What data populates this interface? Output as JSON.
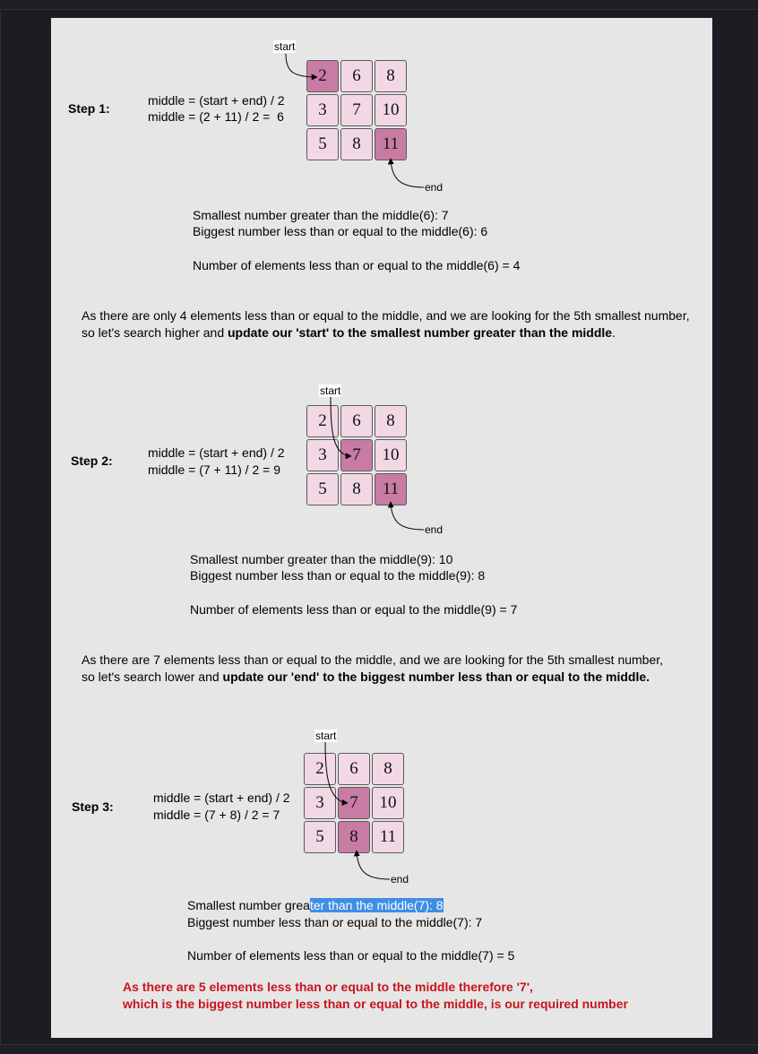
{
  "step1": {
    "label": "Step 1:",
    "formula1": "middle = (start + end) / 2",
    "formula2": "middle = (2 + 11) / 2 =  6",
    "start_tag": "start",
    "end_tag": "end",
    "matrix": [
      [
        "2",
        "6",
        "8"
      ],
      [
        "3",
        "7",
        "10"
      ],
      [
        "5",
        "8",
        "11"
      ]
    ],
    "info1": "Smallest number greater than the middle(6): 7",
    "info2": "Biggest number less than or equal to the middle(6): 6",
    "info3": "Number of elements less than or equal to the middle(6) = 4",
    "para_line1": "As there are only 4 elements less than or equal to the middle, and we are looking for the 5th smallest number,",
    "para_line2_prefix": "so let's search higher and ",
    "para_line2_bold": "update our 'start' to the smallest number greater than the middle",
    "para_line2_suffix": "."
  },
  "step2": {
    "label": "Step 2:",
    "formula1": "middle = (start + end) / 2",
    "formula2": "middle = (7 + 11) / 2 = 9",
    "start_tag": "start",
    "end_tag": "end",
    "matrix": [
      [
        "2",
        "6",
        "8"
      ],
      [
        "3",
        "7",
        "10"
      ],
      [
        "5",
        "8",
        "11"
      ]
    ],
    "info1": "Smallest number greater than the middle(9): 10",
    "info2": "Biggest number less than or equal to the middle(9): 8",
    "info3": "Number of elements less than or equal to the middle(9) = 7",
    "para_line1": "As there are 7 elements less than or equal to the middle, and we are looking for the 5th smallest number,",
    "para_line2_prefix": "so let's search lower and ",
    "para_line2_bold": "update our 'end'  to the biggest number less than or equal to the middle."
  },
  "step3": {
    "label": "Step 3:",
    "formula1": "middle = (start + end) / 2",
    "formula2": "middle = (7 + 8) / 2 = 7",
    "start_tag": "start",
    "end_tag": "end",
    "matrix": [
      [
        "2",
        "6",
        "8"
      ],
      [
        "3",
        "7",
        "10"
      ],
      [
        "5",
        "8",
        "11"
      ]
    ],
    "info1_a": "Smallest number grea",
    "info1_b": "ter than the middle(7): 8",
    "info2": "Biggest number less than or equal to the middle(7): 7",
    "info3": "Number of elements less than or equal to the middle(7) = 5",
    "final1": "As there are 5 elements less than or equal to the middle therefore '7',",
    "final2": "which is the biggest number less than or equal to the middle, is our required number"
  },
  "colors": {
    "cell_fill": "#f2d8e4",
    "cell_highlight": "#c87ca3",
    "final_text": "#c8141c",
    "selection": "#3d8fe6"
  }
}
